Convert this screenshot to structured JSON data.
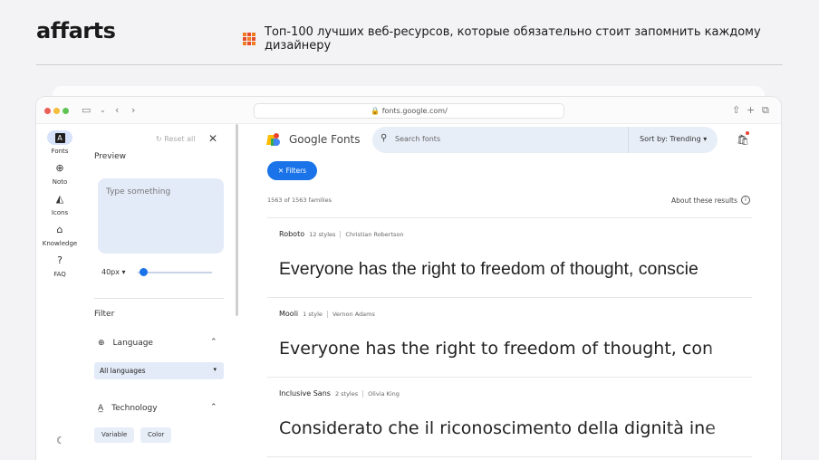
{
  "header": {
    "logo": "affarts",
    "headline": "Топ-100 лучших веб-ресурсов, которые обязательно стоит запомнить каждому дизайнеру",
    "accent_color": "#e84b2c"
  },
  "browser": {
    "url": "fonts.google.com/"
  },
  "rail": {
    "items": [
      {
        "label": "Fonts",
        "icon": "fonts-icon"
      },
      {
        "label": "Noto",
        "icon": "globe-icon"
      },
      {
        "label": "Icons",
        "icon": "shapes-icon"
      },
      {
        "label": "Knowledge",
        "icon": "school-icon"
      },
      {
        "label": "FAQ",
        "icon": "help-icon"
      }
    ]
  },
  "panel": {
    "reset_label": "Reset all",
    "preview_label": "Preview",
    "preview_placeholder": "Type something",
    "size_value": "40px",
    "filter_label": "Filter",
    "language_label": "Language",
    "language_value": "All languages",
    "technology_label": "Technology",
    "chips": [
      "Variable",
      "Color"
    ]
  },
  "main": {
    "brand": "Google Fonts",
    "search_placeholder": "Search fonts",
    "sort_label": "Sort by: Trending",
    "filters_button": "Filters",
    "results_count": "1563 of 1563 families",
    "about_results": "About these results",
    "fonts": [
      {
        "name": "Roboto",
        "styles": "12 styles",
        "designer": "Christian Robertson",
        "sample": "Everyone has the right to freedom of thought, conscie"
      },
      {
        "name": "Mooli",
        "styles": "1 style",
        "designer": "Vernon Adams",
        "sample": "Everyone has the right to freedom of thought, con"
      },
      {
        "name": "Inclusive Sans",
        "styles": "2 styles",
        "designer": "Olivia King",
        "sample": "Considerato che il riconoscimento della dignità ine"
      }
    ]
  }
}
